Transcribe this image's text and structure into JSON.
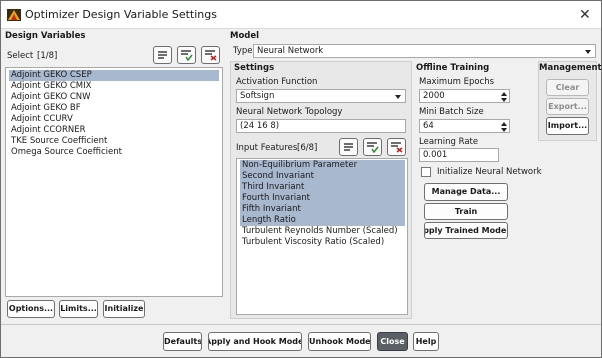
{
  "window": {
    "title": "Optimizer Design Variable Settings"
  },
  "design_variables": {
    "heading": "Design Variables",
    "select_label": "Select",
    "select_count": "[1/8]",
    "items": [
      "Adjoint GEKO CSEP",
      "Adjoint GEKO CMIX",
      "Adjoint GEKO CNW",
      "Adjoint GEKO BF",
      "Adjoint CCURV",
      "Adjoint CCORNER",
      "TKE Source Coefficient",
      "Omega Source Coefficient"
    ],
    "buttons": {
      "options": "Options...",
      "limits": "Limits...",
      "initialize": "Initialize"
    }
  },
  "model": {
    "heading": "Model",
    "type_label": "Type",
    "type_value": "Neural Network"
  },
  "settings": {
    "heading": "Settings",
    "activation_label": "Activation Function",
    "activation_value": "Softsign",
    "topology_label": "Neural Network Topology",
    "topology_value": "(24 16 8)",
    "input_features_label": "Input Features",
    "input_features_count": "[6/8]",
    "features": [
      "Non-Equilibrium Parameter",
      "Second Invariant",
      "Third Invariant",
      "Fourth Invariant",
      "Fifth Invariant",
      "Length Ratio",
      "Turbulent Reynolds Number (Scaled)",
      "Turbulent Viscosity Ratio (Scaled)"
    ]
  },
  "offline_training": {
    "heading": "Offline Training",
    "max_epochs_label": "Maximum Epochs",
    "max_epochs_value": "2000",
    "batch_size_label": "Mini Batch Size",
    "batch_size_value": "64",
    "learning_rate_label": "Learning Rate",
    "learning_rate_value": "0.001",
    "init_nn_label": "Initialize Neural Network",
    "buttons": {
      "manage": "Manage Data...",
      "train": "Train",
      "apply_trained": "Apply Trained Model"
    }
  },
  "management": {
    "heading": "Management",
    "buttons": {
      "clear": "Clear",
      "export": "Export...",
      "import": "Import..."
    }
  },
  "footer": {
    "defaults": "Defaults",
    "apply_hook": "Apply and Hook Model",
    "unhook": "Unhook Model",
    "close": "Close",
    "help": "Help"
  },
  "colors": {
    "selection": "#a8b8cf",
    "close_button": "#5b5f66"
  }
}
